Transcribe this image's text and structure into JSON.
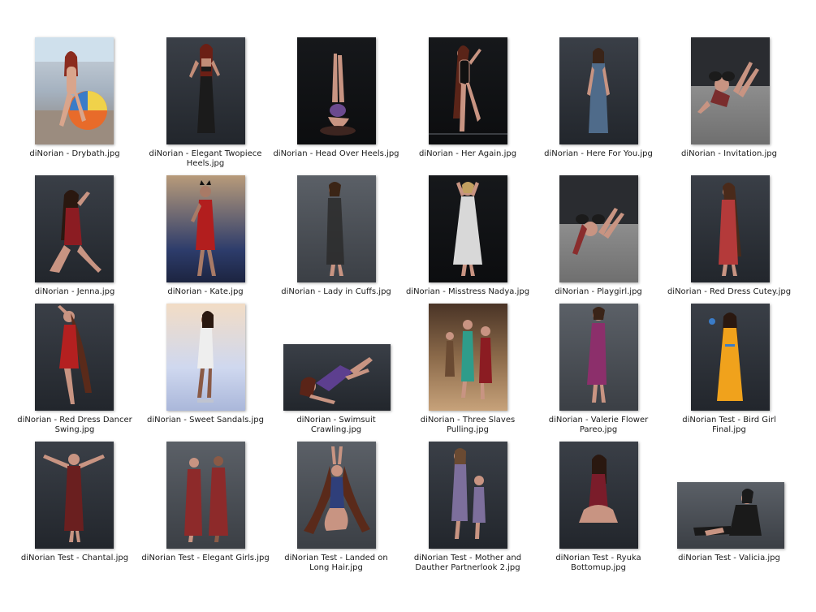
{
  "files": [
    {
      "label": "diNorian - Drybath.jpg",
      "figure_color": "#d9a58c",
      "accent": "#e24a2b"
    },
    {
      "label": "diNorian - Elegant Twopiece Heels.jpg",
      "figure_color": "#c28d78",
      "accent": "#1b1b1b"
    },
    {
      "label": "diNorian - Head Over Heels.jpg",
      "figure_color": "#c89482",
      "accent": "#6b4a8f"
    },
    {
      "label": "diNorian - Her Again.jpg",
      "figure_color": "#c89482",
      "accent": "#111111"
    },
    {
      "label": "diNorian - Here For You.jpg",
      "figure_color": "#c89482",
      "accent": "#4f6b8a"
    },
    {
      "label": "diNorian - Invitation.jpg",
      "figure_color": "#c89482",
      "accent": "#7a2d2d"
    },
    {
      "label": "diNorian - Jenna.jpg",
      "figure_color": "#c89482",
      "accent": "#8b1c22"
    },
    {
      "label": "diNorian - Kate.jpg",
      "figure_color": "#c89482",
      "accent": "#b21e1e"
    },
    {
      "label": "diNorian - Lady in Cuffs.jpg",
      "figure_color": "#c89482",
      "accent": "#2b2b2b"
    },
    {
      "label": "diNorian - Misstress Nadya.jpg",
      "figure_color": "#c89482",
      "accent": "#d8d8d8"
    },
    {
      "label": "diNorian - Playgirl.jpg",
      "figure_color": "#c89482",
      "accent": "#8a2d2d"
    },
    {
      "label": "diNorian - Red Dress Cutey.jpg",
      "figure_color": "#c89482",
      "accent": "#b43a3a"
    },
    {
      "label": "diNorian - Red Dress Dancer Swing.jpg",
      "figure_color": "#c89482",
      "accent": "#b42020"
    },
    {
      "label": "diNorian - Sweet Sandals.jpg",
      "figure_color": "#c89482",
      "accent": "#eeeeee"
    },
    {
      "label": "diNorian - Swimsuit Crawling.jpg",
      "figure_color": "#c89482",
      "accent": "#5d3f8f"
    },
    {
      "label": "diNorian - Three Slaves Pulling.jpg",
      "figure_color": "#c89482",
      "accent": "#2f9c8a"
    },
    {
      "label": "diNorian - Valerie Flower Pareo.jpg",
      "figure_color": "#c89482",
      "accent": "#8c2f6b"
    },
    {
      "label": "diNorian Test - Bird Girl Final.jpg",
      "figure_color": "#c89482",
      "accent": "#f0a21c"
    },
    {
      "label": "diNorian Test - Chantal.jpg",
      "figure_color": "#c89482",
      "accent": "#6a1f1f"
    },
    {
      "label": "diNorian Test - Elegant Girls.jpg",
      "figure_color": "#c89482",
      "accent": "#8d2a2a"
    },
    {
      "label": "diNorian Test - Landed on Long Hair.jpg",
      "figure_color": "#c89482",
      "accent": "#2f3f7a"
    },
    {
      "label": "diNorian Test - Mother and Dauther Partnerlook 2.jpg",
      "figure_color": "#c89482",
      "accent": "#7d6f9c"
    },
    {
      "label": "diNorian Test - Ryuka Bottomup.jpg",
      "figure_color": "#c89482",
      "accent": "#7a1c2a"
    },
    {
      "label": "diNorian Test - Valicia.jpg",
      "figure_color": "#c89482",
      "accent": "#1a1a1a"
    }
  ]
}
